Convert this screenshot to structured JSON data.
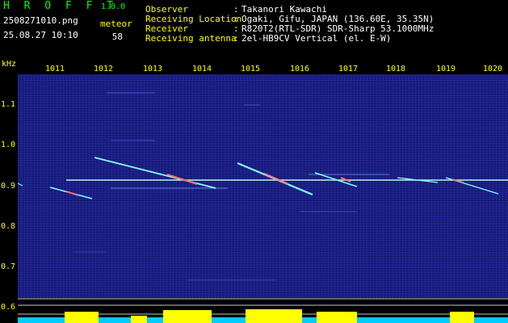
{
  "header": {
    "title": "H R O F F T",
    "version": "1.0.0",
    "filename": "2508271010.png",
    "timestamp": "25.08.27 10:10",
    "meteor_label": "meteor",
    "meteor_count": "58"
  },
  "info": [
    {
      "label": "Observer",
      "value": "Takanori Kawachi"
    },
    {
      "label": "Receiving Location",
      "value": "Ogaki, Gifu, JAPAN (136.60E, 35.35N)"
    },
    {
      "label": "Receiver",
      "value": "R820T2(RTL-SDR) SDR-Sharp 53.1000MHz"
    },
    {
      "label": "Receiving antenna",
      "value": "2el-HB9CV Vertical (el. E-W)"
    }
  ],
  "spectrogram": {
    "y_unit": "kHz",
    "x_ticks": [
      "1011",
      "1012",
      "1013",
      "1014",
      "1015",
      "1016",
      "1017",
      "1018",
      "1019",
      "1020"
    ],
    "y_ticks": [
      "1.1",
      "1.0",
      "0.9",
      "0.8",
      "0.7",
      "0.6"
    ],
    "colors": {
      "background": "#1a1e86",
      "axis_text": "#ffff00",
      "trail": "#7fffff",
      "hot": "#ff6a6a",
      "power": "#00ccff",
      "power_peak": "#ffff00"
    }
  }
}
